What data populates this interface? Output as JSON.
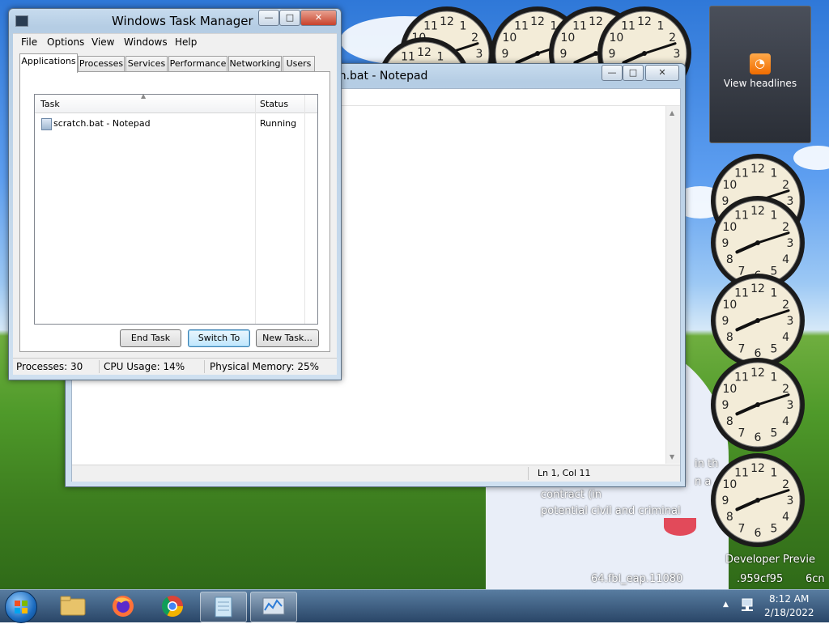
{
  "desktop": {
    "overlay_lines": [
      "contract (in",
      "potential civil and criminal",
      "Developer Previe",
      "64.fbl_eap.11080",
      ".959cf95",
      "6cn",
      "in th",
      "n a"
    ]
  },
  "headlines_gadget": {
    "label": "View headlines",
    "icon": "rss-icon"
  },
  "clocks": [
    {
      "hour": 9,
      "minute": 12
    },
    {
      "hour": 8,
      "minute": 12
    },
    {
      "hour": 8,
      "minute": 12
    },
    {
      "hour": 8,
      "minute": 12
    },
    {
      "hour": 8,
      "minute": 12
    },
    {
      "hour": 8,
      "minute": 12
    },
    {
      "hour": 8,
      "minute": 12
    },
    {
      "hour": 8,
      "minute": 12
    },
    {
      "hour": 8,
      "minute": 12
    },
    {
      "hour": 8,
      "minute": 12
    }
  ],
  "notepad": {
    "title": "scratch.bat - Notepad",
    "visible_title": "ch.bat - Notepad",
    "status_position": "Ln 1, Col 11"
  },
  "taskmgr": {
    "title": "Windows Task Manager",
    "menu": [
      "File",
      "Options",
      "View",
      "Windows",
      "Help"
    ],
    "tabs": [
      "Applications",
      "Processes",
      "Services",
      "Performance",
      "Networking",
      "Users"
    ],
    "active_tab": "Applications",
    "columns": {
      "task": "Task",
      "status": "Status"
    },
    "rows": [
      {
        "task": "scratch.bat - Notepad",
        "status": "Running"
      }
    ],
    "buttons": {
      "end_task": "End Task",
      "switch_to": "Switch To",
      "new_task": "New Task..."
    },
    "status_bar": {
      "processes": "Processes: 30",
      "cpu": "CPU Usage: 14%",
      "memory": "Physical Memory: 25%"
    }
  },
  "taskbar": {
    "time": "8:12 AM",
    "date": "2/18/2022",
    "items": [
      "start-button",
      "explorer-icon",
      "firefox-icon",
      "chrome-icon",
      "notepad-taskbar-icon",
      "task-manager-taskbar-icon"
    ]
  }
}
